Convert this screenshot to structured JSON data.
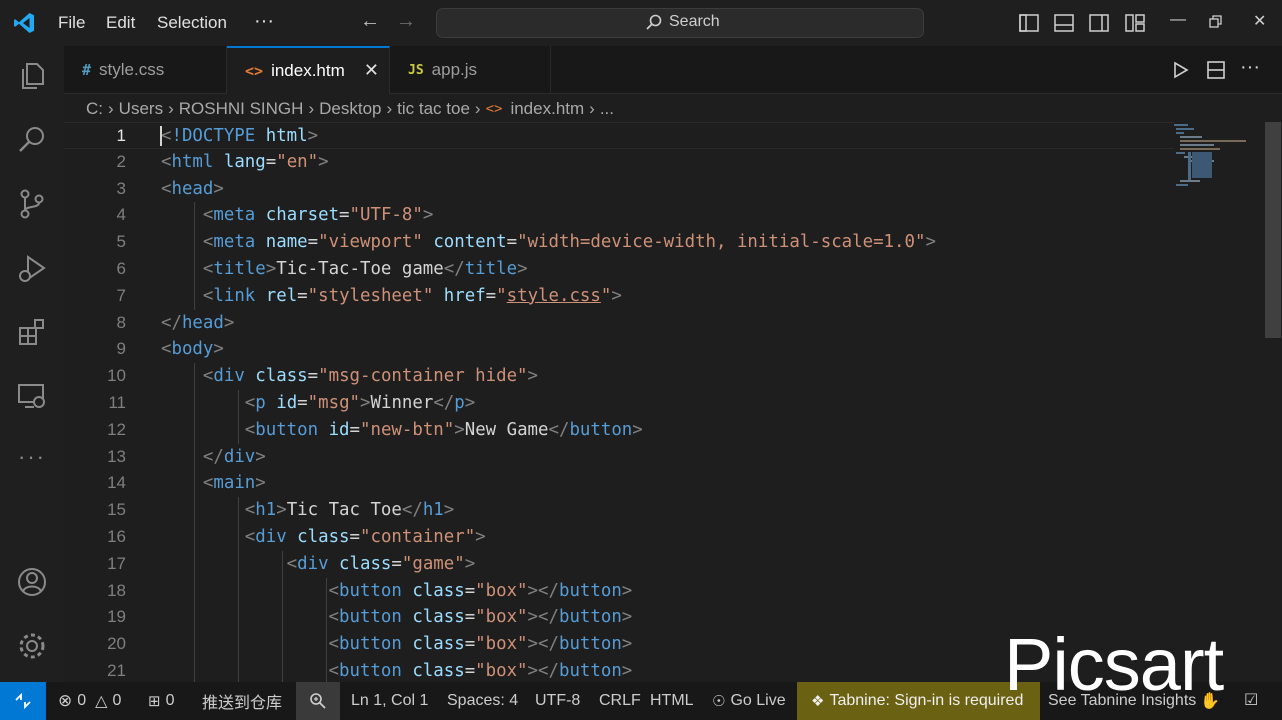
{
  "titlebar": {
    "menu": [
      "File",
      "Edit",
      "Selection",
      "···"
    ],
    "search_placeholder": "Search"
  },
  "tabs": [
    {
      "icon": "#",
      "label": "style.css",
      "icon_color": "#519aba"
    },
    {
      "icon": "<>",
      "label": "index.htm",
      "icon_color": "#e37933",
      "active": true
    },
    {
      "icon": "JS",
      "label": "app.js",
      "icon_color": "#cbcb41"
    }
  ],
  "breadcrumb": [
    "C:",
    "Users",
    "ROSHNI SINGH",
    "Desktop",
    "tic tac toe",
    "index.htm",
    "..."
  ],
  "editor": {
    "line_numbers": [
      "1",
      "2",
      "3",
      "4",
      "5",
      "6",
      "7",
      "8",
      "9",
      "10",
      "11",
      "12",
      "13",
      "14",
      "15",
      "16",
      "17",
      "18",
      "19",
      "20",
      "21"
    ],
    "lines": [
      "<!DOCTYPE html>",
      "<html lang=\"en\">",
      "<head>",
      "    <meta charset=\"UTF-8\">",
      "    <meta name=\"viewport\" content=\"width=device-width, initial-scale=1.0\">",
      "    <title>Tic-Tac-Toe game</title>",
      "    <link rel=\"stylesheet\" href=\"style.css\">",
      "</head>",
      "<body>",
      "    <div class=\"msg-container hide\">",
      "        <p id=\"msg\">Winner</p>",
      "        <button id=\"new-btn\">New Game</button>",
      "    </div>",
      "    <main>",
      "        <h1>Tic Tac Toe</h1>",
      "        <div class=\"container\">",
      "            <div class=\"game\">",
      "                <button class=\"box\"></button>",
      "                <button class=\"box\"></button>",
      "                <button class=\"box\"></button>",
      "                <button class=\"box\"></button>"
    ]
  },
  "statusbar": {
    "errors": "0",
    "warnings": "0",
    "ports": "0",
    "push": "推送到仓库",
    "position": "Ln 1, Col 1",
    "spaces": "Spaces: 4",
    "encoding": "UTF-8",
    "eol": "CRLF",
    "language": "HTML",
    "golive": "Go Live",
    "tabnine": "Tabnine: Sign-in is required",
    "insights": "See Tabnine Insights"
  },
  "watermark": "Picsart",
  "colors": {
    "accent": "#0078d4",
    "tabnine_bg": "#6b6112"
  }
}
